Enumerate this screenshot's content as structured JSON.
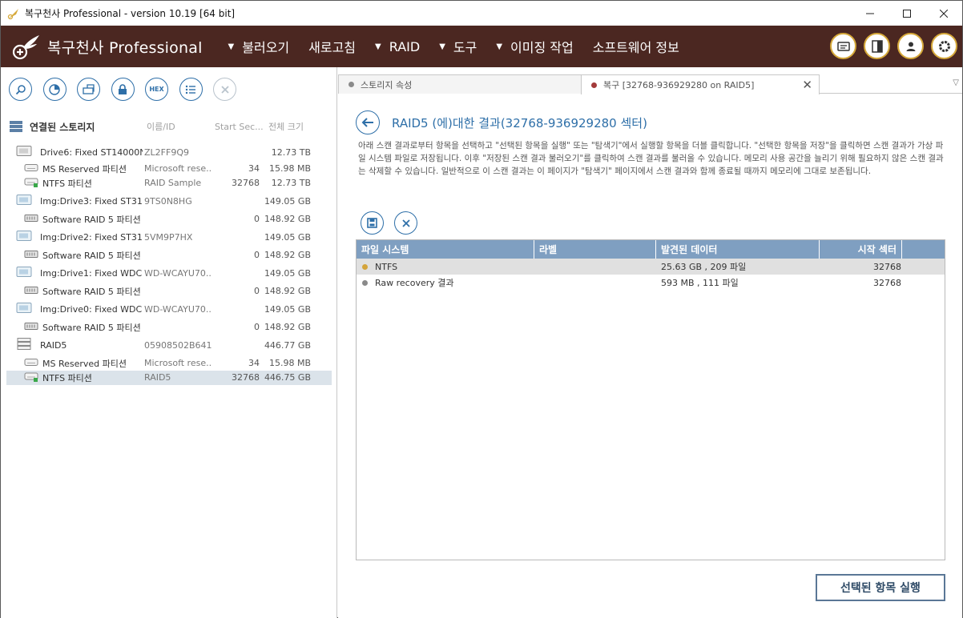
{
  "window": {
    "title": "복구천사 Professional - version 10.19 [64 bit]"
  },
  "menubar": {
    "brand": "복구천사 Professional",
    "items": [
      {
        "label": "불러오기",
        "caret": true
      },
      {
        "label": "새로고침",
        "caret": false
      },
      {
        "label": "RAID",
        "caret": true
      },
      {
        "label": "도구",
        "caret": true
      },
      {
        "label": "이미징 작업",
        "caret": true
      },
      {
        "label": "소프트웨어 정보",
        "caret": false
      }
    ]
  },
  "left": {
    "header": {
      "label": "연결된 스토리지",
      "col_id": "이름/ID",
      "col_start": "Start Sec...",
      "col_size": "전체 크기"
    },
    "rows": [
      {
        "type": "disk",
        "name": "Drive6: Fixed ST14000N...",
        "id": "ZL2FF9Q9",
        "start": "",
        "size": "12.73 TB"
      },
      {
        "type": "part",
        "name": "MS Reserved 파티션",
        "id": "Microsoft rese...",
        "start": "34",
        "size": "15.98 MB"
      },
      {
        "type": "part-ok",
        "name": "NTFS 파티션",
        "id": "RAID Sample",
        "start": "32768",
        "size": "12.73 TB"
      },
      {
        "type": "img",
        "name": "Img:Drive3: Fixed ST31...",
        "id": "9TS0N8HG",
        "start": "",
        "size": "149.05 GB"
      },
      {
        "type": "raid",
        "name": "Software RAID 5 파티션",
        "id": "",
        "start": "0",
        "size": "148.92 GB"
      },
      {
        "type": "img",
        "name": "Img:Drive2: Fixed ST31...",
        "id": "5VM9P7HX",
        "start": "",
        "size": "149.05 GB"
      },
      {
        "type": "raid",
        "name": "Software RAID 5 파티션",
        "id": "",
        "start": "0",
        "size": "148.92 GB"
      },
      {
        "type": "img",
        "name": "Img:Drive1: Fixed WDC ...",
        "id": "WD-WCAYU70...",
        "start": "",
        "size": "149.05 GB"
      },
      {
        "type": "raid",
        "name": "Software RAID 5 파티션",
        "id": "",
        "start": "0",
        "size": "148.92 GB"
      },
      {
        "type": "img",
        "name": "Img:Drive0: Fixed WDC ...",
        "id": "WD-WCAYU70...",
        "start": "",
        "size": "149.05 GB"
      },
      {
        "type": "raid",
        "name": "Software RAID 5 파티션",
        "id": "",
        "start": "0",
        "size": "148.92 GB"
      },
      {
        "type": "raidset",
        "name": "RAID5",
        "id": "05908502B641...",
        "start": "",
        "size": "446.77 GB"
      },
      {
        "type": "part",
        "name": "MS Reserved 파티션",
        "id": "Microsoft rese...",
        "start": "34",
        "size": "15.98 MB"
      },
      {
        "type": "part-ok",
        "name": "NTFS 파티션",
        "id": "RAID5",
        "start": "32768",
        "size": "446.75 GB",
        "selected": true
      }
    ]
  },
  "tabs": [
    {
      "label": "스토리지 속성",
      "dot": "#8a8a8a"
    },
    {
      "label": "복구 [32768-936929280 on RAID5]",
      "dot": "#a33a3a"
    }
  ],
  "result": {
    "title": "RAID5 (에)대한 결과(32768-936929280 섹터)",
    "description": "아래 스캔 결과로부터 항목을 선택하고 \"선택된 항목을 실행\" 또는 \"탐색기\"에서 실행할 항목을 더블 클릭합니다. \"선택한 항목을 저장\"을 클릭하면 스캔 결과가 가상 파일 시스템 파일로 저장됩니다. 이후 \"저장된 스캔 결과 불러오기\"를 클릭하여 스캔 결과를 불러올 수 있습니다. 메모리 사용 공간을 늘리기 위해 필요하지 않은 스캔 결과는 삭제할 수 있습니다. 일반적으로 이 스캔 결과는 이 페이지가 \"탐색기\" 페이지에서 스캔 결과와 함께 종료될 때까지 메모리에 그대로 보존됩니다."
  },
  "grid": {
    "headers": [
      "파일 시스템",
      "라벨",
      "발견된 데이터",
      "시작 섹터"
    ],
    "rows": [
      {
        "fs": "NTFS",
        "label": "",
        "data": "25.63 GB , 209 파일",
        "sector": "32768",
        "dot": "#d4a43a"
      },
      {
        "fs": "Raw recovery 결과",
        "label": "",
        "data": "593 MB , 111 파일",
        "sector": "32768",
        "dot": "#8a8a8a"
      }
    ]
  },
  "run_button": "선택된 항목 실행"
}
